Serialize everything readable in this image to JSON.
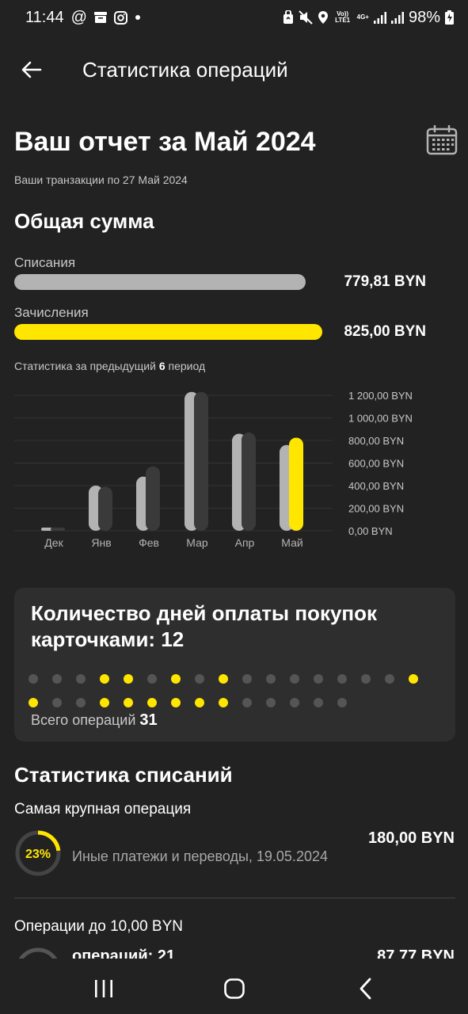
{
  "status_bar": {
    "time": "11:44",
    "battery": "98%",
    "volte": "Vo)) LTE1",
    "net": "4G+"
  },
  "header": {
    "title": "Статистика операций"
  },
  "report": {
    "title": "Ваш отчет за Май 2024",
    "subtitle": "Ваши транзакции по 27 Май 2024"
  },
  "total": {
    "title": "Общая сумма",
    "debit_label": "Списания",
    "debit_amount": "779,81 BYN",
    "debit_fraction": 0.945,
    "credit_label": "Зачисления",
    "credit_amount": "825,00 BYN",
    "credit_fraction": 1.0,
    "period_prefix": "Статистика за предыдущий ",
    "period_count": "6",
    "period_suffix": " период"
  },
  "chart_data": {
    "type": "bar",
    "categories": [
      "Дек",
      "Янв",
      "Фев",
      "Мар",
      "Апр",
      "Май"
    ],
    "series": [
      {
        "name": "Списания",
        "values": [
          20,
          400,
          480,
          1230,
          860,
          760
        ]
      },
      {
        "name": "Зачисления",
        "values": [
          15,
          390,
          570,
          1230,
          870,
          825
        ]
      }
    ],
    "y_ticks": [
      "1 200,00 BYN",
      "1 000,00 BYN",
      "800,00 BYN",
      "600,00 BYN",
      "400,00 BYN",
      "200,00 BYN",
      "0,00 BYN"
    ],
    "y_tick_values": [
      1200,
      1000,
      800,
      600,
      400,
      200,
      0
    ],
    "ylim": [
      0,
      1200
    ],
    "grid": true,
    "colors": {
      "debit": "#b3b3b3",
      "credit": "#3a3a3a",
      "highlight": "#ffe600"
    }
  },
  "days_card": {
    "title": "Количество дней оплаты покупок карточками: 12",
    "dots_row1": [
      false,
      false,
      false,
      true,
      true,
      false,
      true,
      false,
      true,
      false,
      false,
      false,
      false,
      false,
      false,
      false,
      true
    ],
    "dots_row2": [
      true,
      false,
      false,
      true,
      true,
      true,
      true,
      true,
      true,
      false,
      false,
      false,
      false,
      false
    ],
    "total_label": "Всего операций ",
    "total_value": "31"
  },
  "debit_stats": {
    "title": "Статистика списаний",
    "largest_label": "Самая крупная операция",
    "largest_percent": "23%",
    "largest_fraction": 0.23,
    "largest_desc": "Иные платежи и переводы, 19.05.2024",
    "largest_amount": "180,00 BYN",
    "small_label": "Операции до 10,00 BYN",
    "small_desc": "операций: 21",
    "small_amount": "87,77 BYN"
  },
  "colors": {
    "accent": "#ffe600",
    "background": "#222222",
    "card": "#2e2e2e"
  }
}
